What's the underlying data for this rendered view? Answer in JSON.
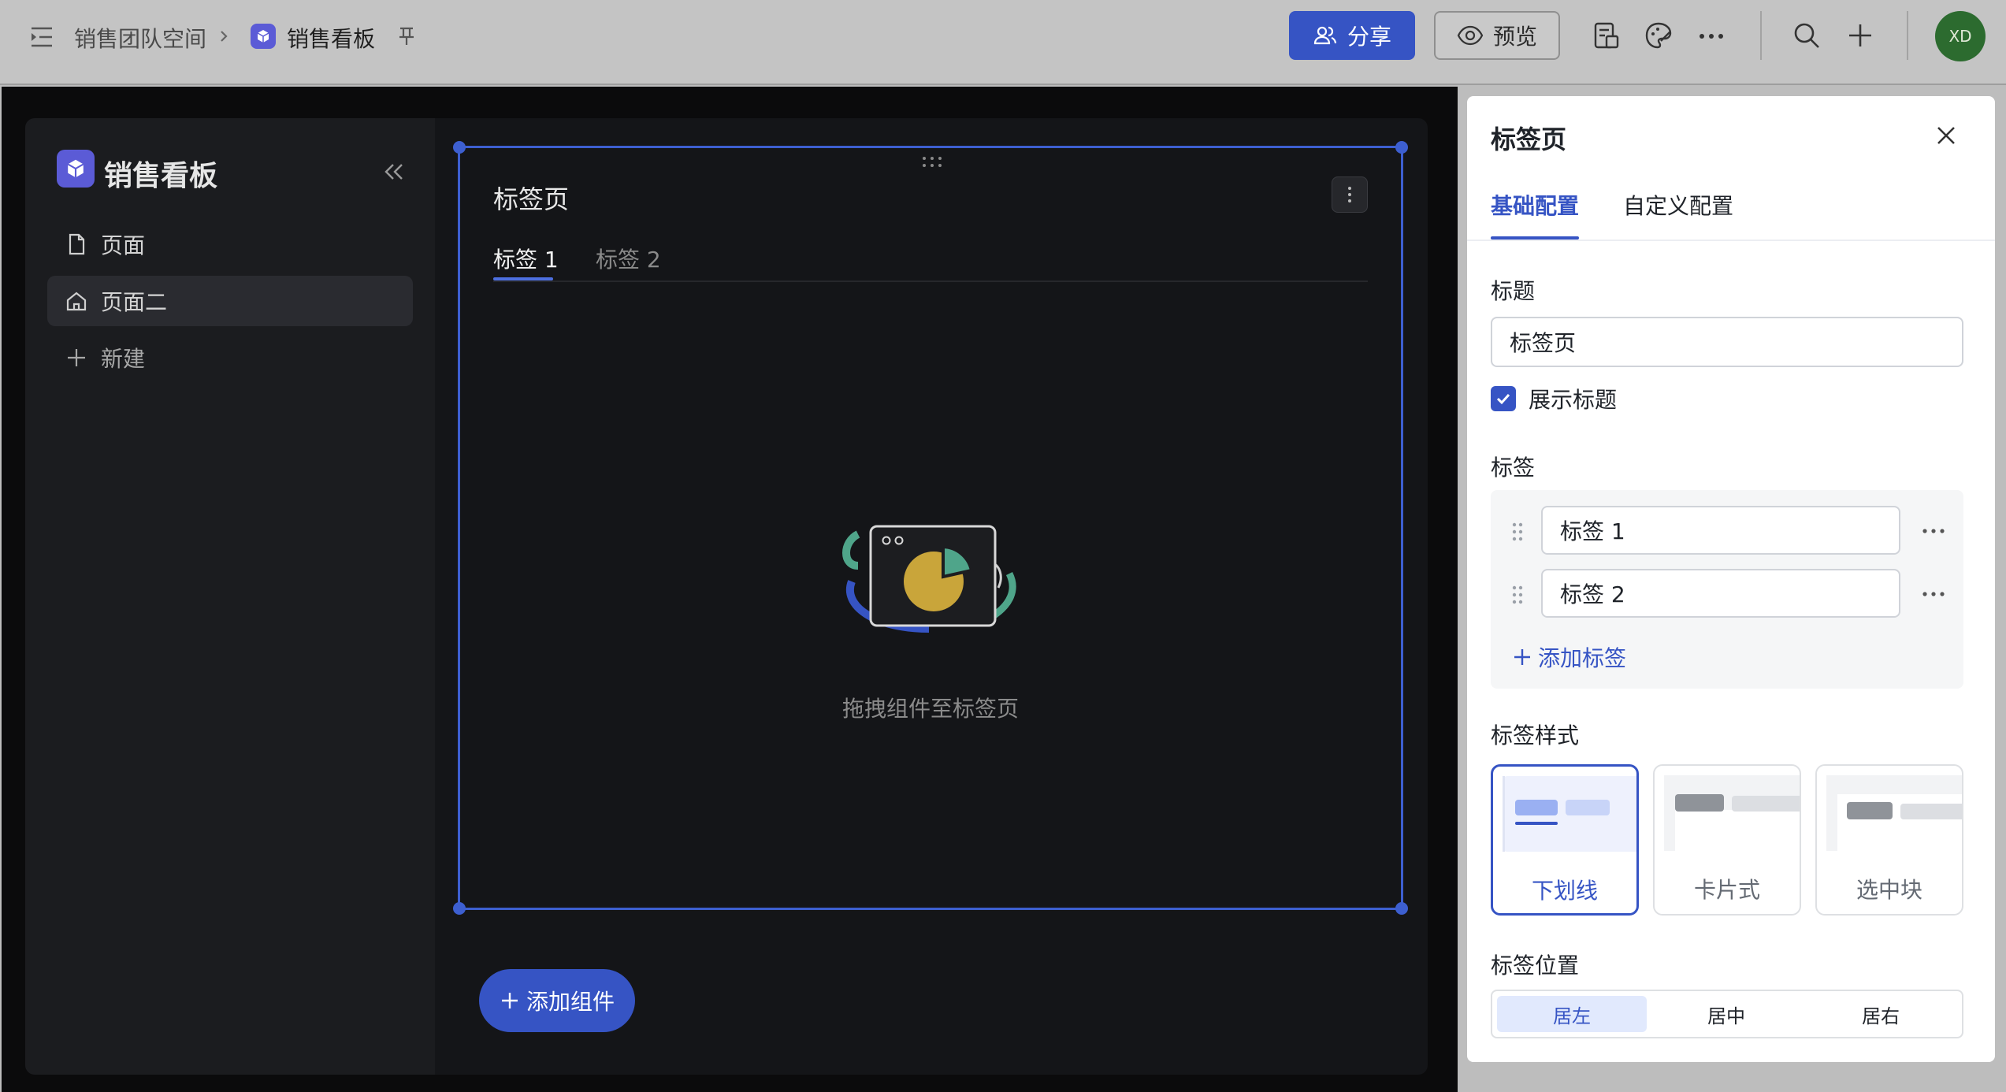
{
  "topbar": {
    "workspace": "销售团队空间",
    "board": "销售看板",
    "share_label": "分享",
    "preview_label": "预览",
    "avatar_initials": "XD"
  },
  "sidebar": {
    "title": "销售看板",
    "items": [
      {
        "label": "页面",
        "icon": "file-icon"
      },
      {
        "label": "页面二",
        "icon": "home-icon",
        "active": true
      },
      {
        "label": "新建",
        "icon": "plus-icon"
      }
    ]
  },
  "widget": {
    "title": "标签页",
    "tabs": [
      "标签 1",
      "标签 2"
    ],
    "empty_text": "拖拽组件至标签页"
  },
  "add_component_label": "添加组件",
  "panel": {
    "title": "标签页",
    "tabs": [
      "基础配置",
      "自定义配置"
    ],
    "title_label": "标题",
    "title_value": "标签页",
    "show_title_label": "展示标题",
    "show_title_checked": true,
    "tags_label": "标签",
    "tags": [
      "标签 1",
      "标签 2"
    ],
    "add_tag_label": "添加标签",
    "style_label": "标签样式",
    "styles": [
      "下划线",
      "卡片式",
      "选中块"
    ],
    "selected_style": "下划线",
    "position_label": "标签位置",
    "positions": [
      "居左",
      "居中",
      "居右"
    ],
    "selected_position": "居左"
  },
  "colors": {
    "accent": "#3654c4",
    "canvas": "#0b0b0c",
    "sidebar": "#1b1c1f"
  }
}
